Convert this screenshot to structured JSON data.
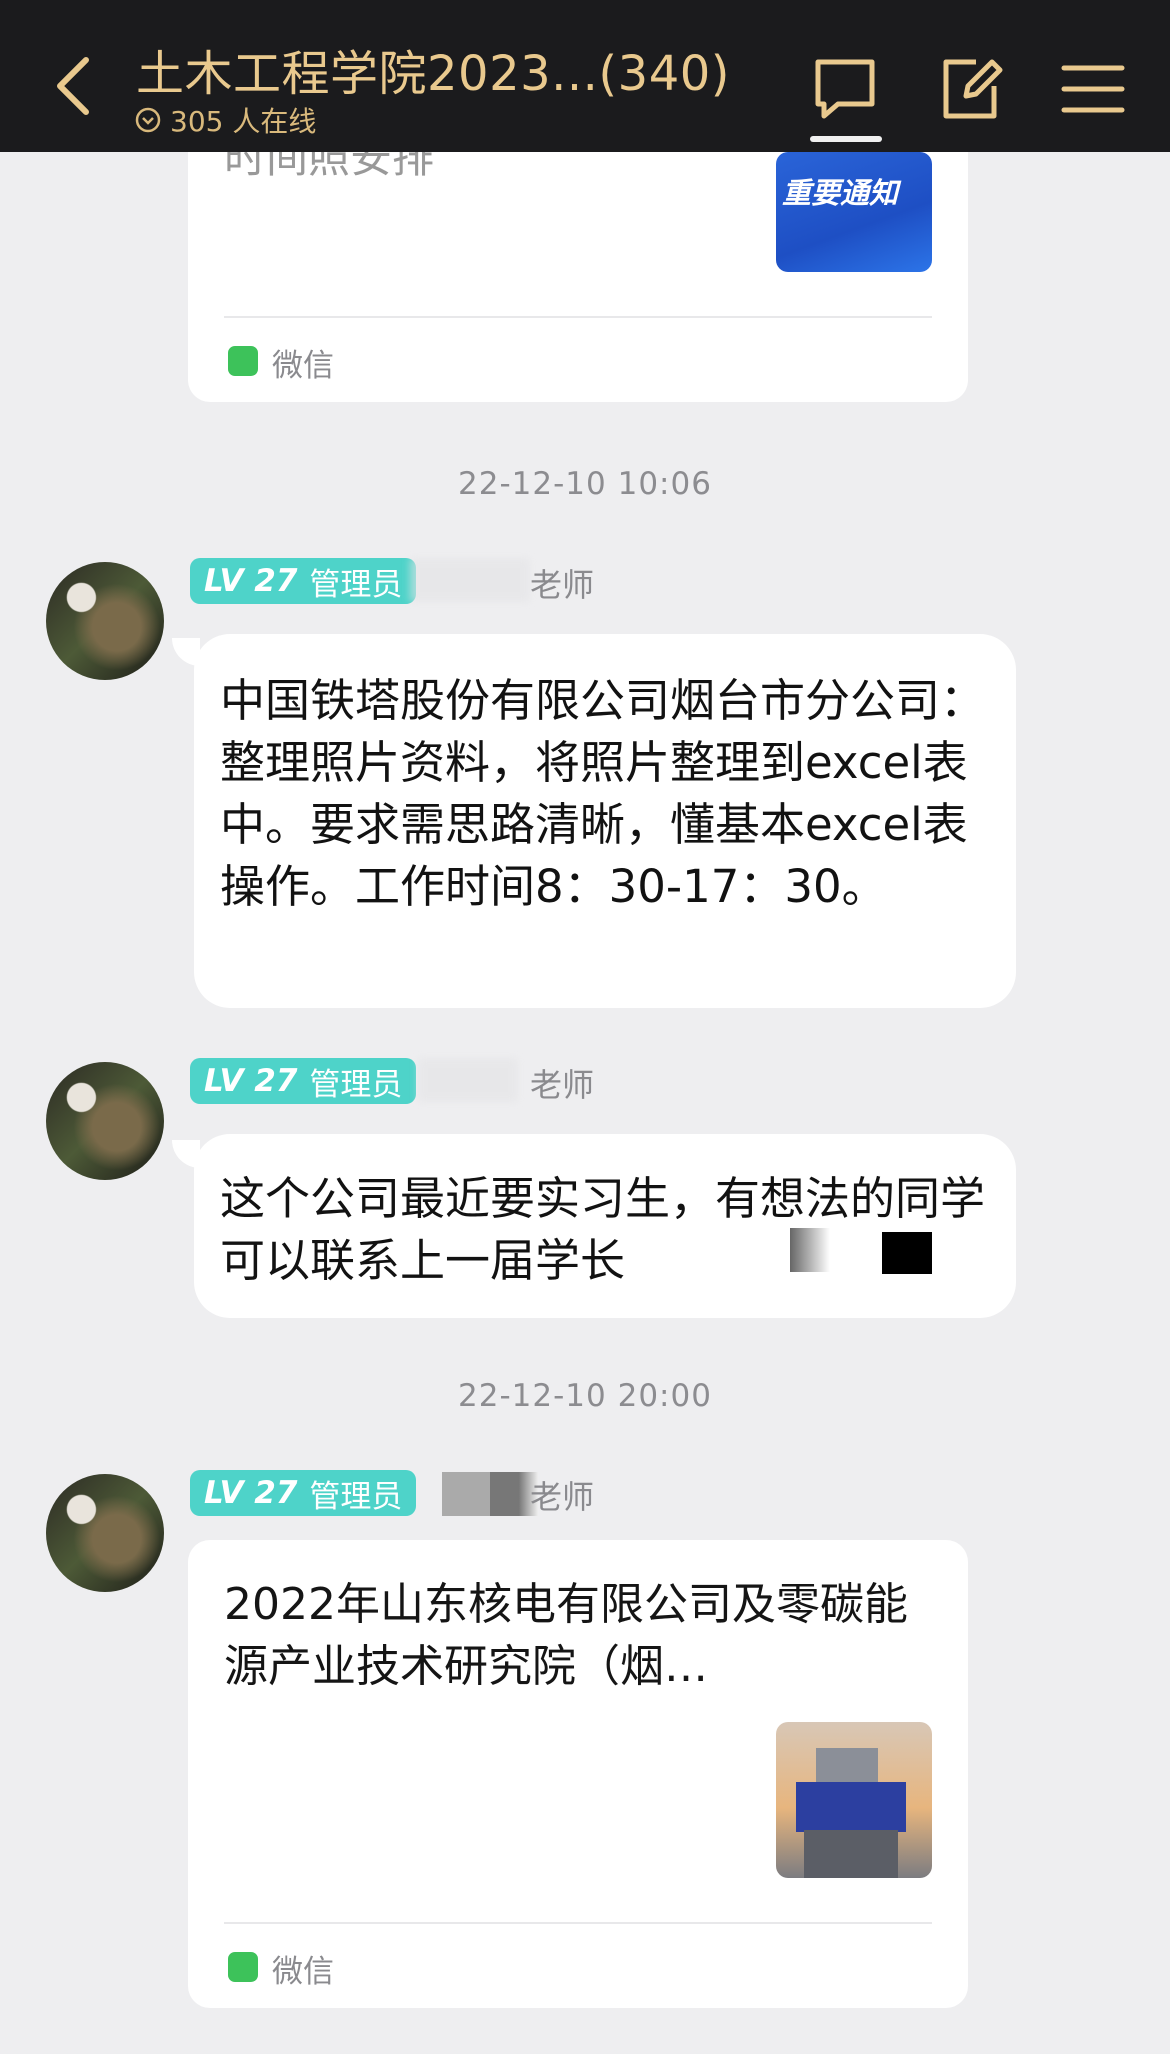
{
  "header": {
    "title": "土木工程学院2023...(340)",
    "online": "305 人在线",
    "icons": [
      "back-icon",
      "chat-icon",
      "edit-icon",
      "menu-icon"
    ]
  },
  "top_card": {
    "partial_text": "时间照安排",
    "thumbnail_text": "重要通知",
    "source": "微信"
  },
  "messages": [
    {
      "timestamp": "22-12-10 10:06",
      "level": "LV 27",
      "role": "管理员",
      "sender": "老师",
      "text": "中国铁塔股份有限公司烟台市分公司：整理照片资料，将照片整理到excel表中。要求需思路清晰，懂基本excel表操作。工作时间8：30-17：30。"
    },
    {
      "level": "LV 27",
      "role": "管理员",
      "sender": "老师",
      "text": "这个公司最近要实习生，有想法的同学可以联系上一届学长"
    },
    {
      "timestamp": "22-12-10 20:00",
      "level": "LV 27",
      "role": "管理员",
      "sender": "老师",
      "link_title": "2022年山东核电有限公司及零碳能源产业技术研究院（烟…",
      "source": "微信"
    }
  ],
  "colors": {
    "header_bg": "#1b1b1d",
    "header_text": "#e9c98e",
    "badge": "#4ed3c9",
    "wechat": "#3dc25a",
    "page_bg": "#eeeef0"
  }
}
